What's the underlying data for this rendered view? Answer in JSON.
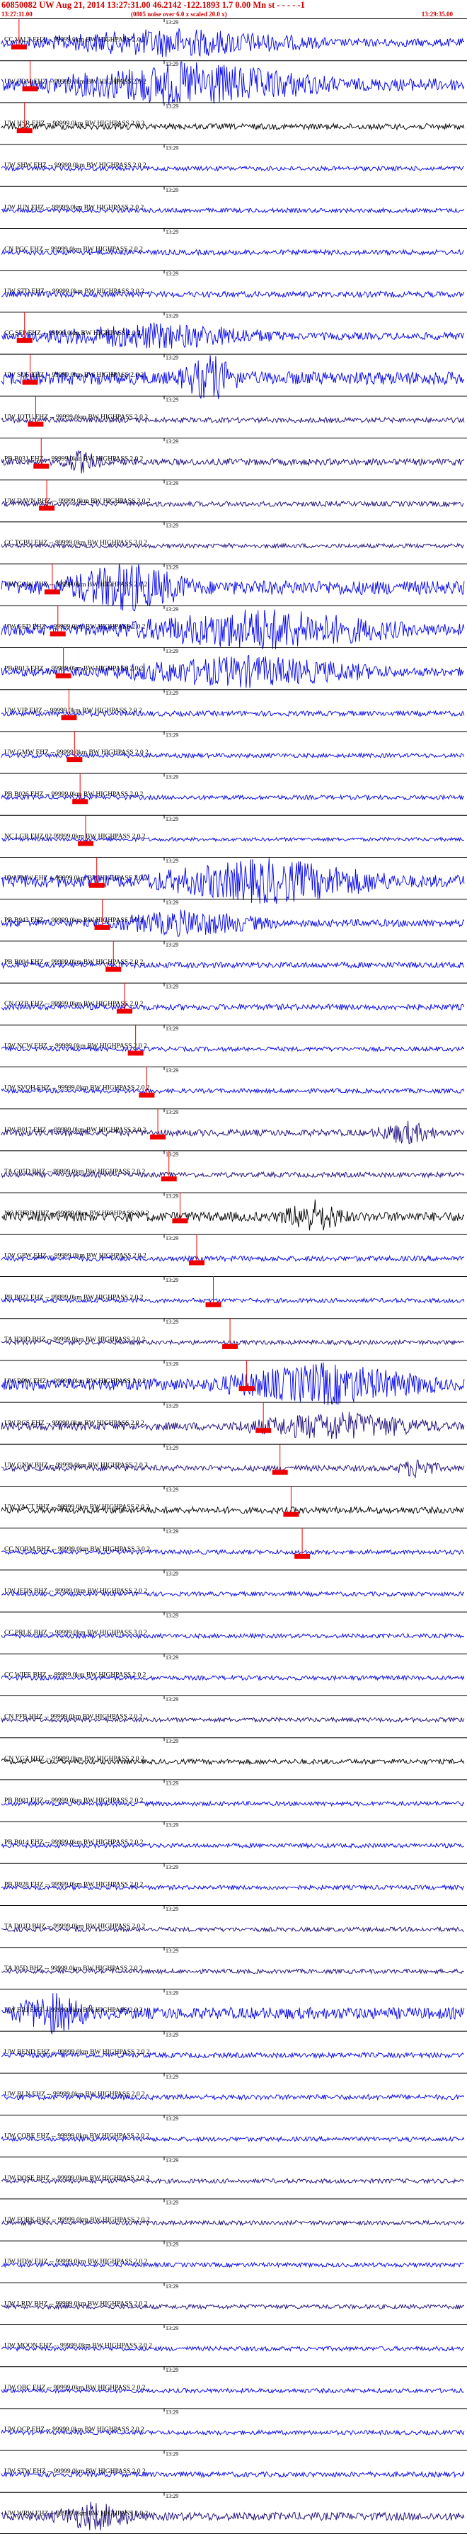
{
  "header": {
    "title": "60850082 UW Aug 21, 2014 13:27:31.00   46.2142  -122.1893   1.7 0.00 Mn st  - -  -  - -1",
    "subtitle": "(0805 noise over 6.0 x scaled 20.0 x)",
    "start_time": "13:27:11.00",
    "end_time": "13:29:35.00"
  },
  "colors": {
    "blue": "#0000ee",
    "navy": "#1a0a7a",
    "black": "#000000",
    "pick": "#ee0000"
  },
  "chart_data": {
    "type": "line",
    "title": "60850082 UW Aug 21, 2014 13:27:31.00   46.2142  -122.1893   1.7 0.00 Mn st",
    "tick_label": "13:29",
    "traces": [
      {
        "label": "CC VALT EHZ -- 99999.0km BW  HIGHPASS  2.0  2",
        "color": "blue",
        "amp": 0.55,
        "burst": [
          0.05,
          0.7
        ],
        "pick": 0.01
      },
      {
        "label": "UW EDM EHZ -- 99999.0km BW  HIGHPASS  2.0  2",
        "color": "blue",
        "amp": 0.85,
        "burst": [
          0.1,
          0.72
        ],
        "pick": 0.03
      },
      {
        "label": "UW HSR EHZ -- 99999.0km BW  HIGHPASS  2.0  2",
        "color": "black",
        "amp": 0.4,
        "burst": null,
        "pick": 0.02
      },
      {
        "label": "UW SHW EHZ -- 99999.0km BW  HIGHPASS  2.0  2",
        "color": "blue",
        "amp": 0.3,
        "burst": null,
        "pick": null
      },
      {
        "label": "UW JUN EHZ -- 99999.0km BW  HIGHPASS  2.0  2",
        "color": "blue",
        "amp": 0.3,
        "burst": null,
        "pick": null
      },
      {
        "label": "CN PGC EHZ -- 99999.0km BW  HIGHPASS  2.0  2",
        "color": "blue",
        "amp": 0.35,
        "burst": null,
        "pick": null
      },
      {
        "label": "UW STD EHZ -- 99999.0km BW  HIGHPASS  3.0  2",
        "color": "blue",
        "amp": 0.4,
        "burst": null,
        "pick": null
      },
      {
        "label": "CC SEP EHZ -- 99999.0km BW  HIGHPASS  2.0  2",
        "color": "blue",
        "amp": 0.5,
        "burst": [
          0.05,
          0.62
        ],
        "pick": 0.02
      },
      {
        "label": "UW SOS EHZ -- 99999.0km BW  HIGHPASS  2.0  2",
        "color": "blue",
        "amp": 0.9,
        "burst": [
          0.38,
          0.52
        ],
        "pick": 0.03
      },
      {
        "label": "UW JOTU EHZ -- 99999.0km BW  HIGHPASS  2.0  2",
        "color": "navy",
        "amp": 0.35,
        "burst": null,
        "pick": 0.04
      },
      {
        "label": "PB B031 EHZ -- 99999.0km BW  HIGHPASS  2.0  2",
        "color": "navy",
        "amp": 0.45,
        "burst": [
          0.12,
          0.22
        ],
        "pick": 0.05
      },
      {
        "label": "UW DAVN BHZ -- 99999.0km BW  HIGHPASS  3.0  2",
        "color": "navy",
        "amp": 0.35,
        "burst": null,
        "pick": 0.06
      },
      {
        "label": "CC TCBU EHZ -- 99999.0km BW  HIGHPASS  3.0  2",
        "color": "navy",
        "amp": 0.3,
        "burst": null,
        "pick": null
      },
      {
        "label": "UW GOW EHZ -- 99999.0km BW  HIGHPASS  2.0  2",
        "color": "blue",
        "amp": 0.95,
        "burst": [
          0.12,
          0.42
        ],
        "pick": 0.07
      },
      {
        "label": "UW GED EHZ -- 99999.0km BW  HIGHPASS  2.0  2",
        "color": "blue",
        "amp": 0.8,
        "burst": [
          0.25,
          0.88
        ],
        "pick": 0.08
      },
      {
        "label": "PB B013 EHZ -- 99999.0km BW  HIGHPASS  2.0  2",
        "color": "blue",
        "amp": 0.6,
        "burst": [
          0.2,
          0.85
        ],
        "pick": 0.09
      },
      {
        "label": "UW VIP EHZ -- 99999.0km BW  HIGHPASS  2.0  2",
        "color": "blue",
        "amp": 0.35,
        "burst": null,
        "pick": 0.1
      },
      {
        "label": "UW GMW EHZ -- 99999.0km BW  HIGHPASS  2.0  2",
        "color": "blue",
        "amp": 0.3,
        "burst": null,
        "pick": 0.11
      },
      {
        "label": "PB B026 EHZ -- 99999.0km BW  HIGHPASS  2.0  2",
        "color": "blue",
        "amp": 0.3,
        "burst": null,
        "pick": 0.12
      },
      {
        "label": "NC LGB EHZ 02 99999.0km BW  HIGHPASS  2.0  2",
        "color": "blue",
        "amp": 0.25,
        "burst": null,
        "pick": 0.13
      },
      {
        "label": "UW FMW EHZ -- 99999.0km BW  HIGHPASS  2.0  2",
        "color": "blue",
        "amp": 0.85,
        "burst": [
          0.3,
          0.85
        ],
        "pick": 0.15
      },
      {
        "label": "PB B943 EHZ -- 99999.0km BW  HIGHPASS  2.0  2",
        "color": "blue",
        "amp": 0.5,
        "burst": [
          0.2,
          0.6
        ],
        "pick": 0.16
      },
      {
        "label": "PB B004 EHZ -- 99999.0km BW  HIGHPASS  2.0  2",
        "color": "blue",
        "amp": 0.4,
        "burst": null,
        "pick": 0.18
      },
      {
        "label": "CN OZB EHZ -- 99999.0km BW  HIGHPASS  2.0  2",
        "color": "blue",
        "amp": 0.4,
        "burst": null,
        "pick": 0.2
      },
      {
        "label": "UW NCW EHZ -- 99999.0km BW  HIGHPASS  2.0  2",
        "color": "blue",
        "amp": 0.3,
        "burst": null,
        "pick": 0.22
      },
      {
        "label": "UW SVOH EHZ -- 99999.0km BW  HIGHPASS  2.0  2",
        "color": "blue",
        "amp": 0.3,
        "burst": null,
        "pick": 0.24
      },
      {
        "label": "UW B017 EHZ -- 99999.0km BW  HIGHPASS  2.0  2",
        "color": "navy",
        "amp": 0.45,
        "burst": [
          0.8,
          0.95
        ],
        "pick": 0.26
      },
      {
        "label": "TA G05D BHZ -- 99999.0km BW  HIGHPASS  2.0  2",
        "color": "navy",
        "amp": 0.35,
        "burst": null,
        "pick": 0.28
      },
      {
        "label": "NC KHBB HHZ -- 99999.0km BW  HIGHPASS  2.0  2",
        "color": "black",
        "amp": 0.65,
        "burst": [
          0.6,
          0.75
        ],
        "pick": 0.3
      },
      {
        "label": "UW GPW EHZ -- 99999.0km BW  HIGHPASS  2.0  2",
        "color": "blue",
        "amp": 0.35,
        "burst": null,
        "pick": 0.33
      },
      {
        "label": "PB B022 EHZ -- 99999.0km BW  HIGHPASS  2.0  2",
        "color": "blue",
        "amp": 0.3,
        "burst": null,
        "pick": 0.36
      },
      {
        "label": "TA H30D BHZ -- 99999.0km BW  HIGHPASS  2.0  2",
        "color": "navy",
        "amp": 0.3,
        "burst": null,
        "pick": 0.39
      },
      {
        "label": "UW RPW EHZ -- 99999.0km BW  HIGHPASS  2.0  2",
        "color": "blue",
        "amp": 0.8,
        "burst": [
          0.45,
          0.95
        ],
        "pick": 0.42
      },
      {
        "label": "UW RCS EHZ -- 99999.0km BW  HIGHPASS  2.0  2",
        "color": "navy",
        "amp": 0.55,
        "burst": [
          0.5,
          0.95
        ],
        "pick": 0.45
      },
      {
        "label": "UW GNW BHZ -- 99999.0km BW  HIGHPASS  2.0  2",
        "color": "navy",
        "amp": 0.4,
        "burst": [
          0.85,
          0.95
        ],
        "pick": 0.48
      },
      {
        "label": "UW YACT HHZ -- 99999.0km BW  HIGHPASS  2.0  2",
        "color": "black",
        "amp": 0.45,
        "burst": null,
        "pick": 0.5
      },
      {
        "label": "CC NORM BHZ -- 99999.0km BW  HIGHPASS  3.0  2",
        "color": "blue",
        "amp": 0.3,
        "burst": null,
        "pick": 0.52
      },
      {
        "label": "UW JEDS BHZ -- 99999.0km BW  HIGHPASS  2.0  2",
        "color": "blue",
        "amp": 0.3,
        "burst": null,
        "pick": null
      },
      {
        "label": "CC PRLK BHZ -- 99999.0km BW  HIGHPASS  3.0  2",
        "color": "blue",
        "amp": 0.3,
        "burst": null,
        "pick": null
      },
      {
        "label": "CC WIFE BHZ -- 99999.0km BW  HIGHPASS  2.0  2",
        "color": "blue",
        "amp": 0.3,
        "burst": null,
        "pick": null
      },
      {
        "label": "CN PFB HHZ -- 99999.0km BW  HIGHPASS  2.0  2",
        "color": "navy",
        "amp": 0.3,
        "burst": null,
        "pick": null
      },
      {
        "label": "CN VGZ HHZ -- 99999.0km BW  HIGHPASS  2.0  2",
        "color": "black",
        "amp": 0.35,
        "burst": null,
        "pick": null
      },
      {
        "label": "PB B001 EHZ -- 99999.0km BW  HIGHPASS  2.0  2",
        "color": "blue",
        "amp": 0.3,
        "burst": null,
        "pick": null
      },
      {
        "label": "PB B014 EHZ -- 99999.0km BW  HIGHPASS  2.0  2",
        "color": "blue",
        "amp": 0.3,
        "burst": null,
        "pick": null
      },
      {
        "label": "PB B928 EHZ -- 99999.0km BW  HIGHPASS  2.0  2",
        "color": "blue",
        "amp": 0.3,
        "burst": null,
        "pick": null
      },
      {
        "label": "TA D03D BHZ -- 99999.0km BW  HIGHPASS  2.0  2",
        "color": "navy",
        "amp": 0.3,
        "burst": null,
        "pick": null
      },
      {
        "label": "TA I05D BHZ -- 99999.0km BW  HIGHPASS  2.0  2",
        "color": "navy",
        "amp": 0.3,
        "burst": null,
        "pick": null
      },
      {
        "label": "UW BRI EHZ -- 99999.0km BW  HIGHPASS  2.0  2",
        "color": "blue",
        "amp": 0.8,
        "burst": [
          0.02,
          0.2
        ],
        "pick": null
      },
      {
        "label": "UW BEND EHZ -- 99999.0km BW  HIGHPASS  2.0  2",
        "color": "blue",
        "amp": 0.35,
        "burst": null,
        "pick": null
      },
      {
        "label": "UW BLN EHZ -- 99999.0km BW  HIGHPASS  2.0  2",
        "color": "blue",
        "amp": 0.35,
        "burst": null,
        "pick": null
      },
      {
        "label": "UW CORE EHZ -- 99999.0km BW  HIGHPASS  2.0  2",
        "color": "blue",
        "amp": 0.3,
        "burst": null,
        "pick": null
      },
      {
        "label": "UW DOSE BHZ -- 99999.0km BW  HIGHPASS  2.0  2",
        "color": "navy",
        "amp": 0.3,
        "burst": null,
        "pick": null
      },
      {
        "label": "UW FORK BHZ -- 99999.0km BW  HIGHPASS  2.0  2",
        "color": "navy",
        "amp": 0.3,
        "burst": null,
        "pick": null
      },
      {
        "label": "UW HDW EHZ -- 99999.0km BW  HIGHPASS  2.0  2",
        "color": "blue",
        "amp": 0.3,
        "burst": null,
        "pick": null
      },
      {
        "label": "UW LRIV BHZ -- 99999.0km BW  HIGHPASS  2.0  2",
        "color": "navy",
        "amp": 0.3,
        "burst": null,
        "pick": null
      },
      {
        "label": "UW MOON EHZ -- 99999.0km BW  HIGHPASS  2.0  2",
        "color": "blue",
        "amp": 0.3,
        "burst": null,
        "pick": null
      },
      {
        "label": "UW OBC EHZ -- 99999.0km BW  HIGHPASS  2.0  2",
        "color": "blue",
        "amp": 0.3,
        "burst": null,
        "pick": null
      },
      {
        "label": "UW OCP EHZ -- 99999.0km BW  HIGHPASS  2.0  2",
        "color": "blue",
        "amp": 0.3,
        "burst": null,
        "pick": null
      },
      {
        "label": "UW STW EHZ -- 99999.0km BW  HIGHPASS  2.0  2",
        "color": "blue",
        "amp": 0.35,
        "burst": null,
        "pick": null
      },
      {
        "label": "UW WRW EHZ -- 99999.0km BW  HIGHPASS  2.0  2",
        "color": "navy",
        "amp": 0.55,
        "burst": [
          0.1,
          0.3
        ],
        "pick": null
      }
    ]
  }
}
